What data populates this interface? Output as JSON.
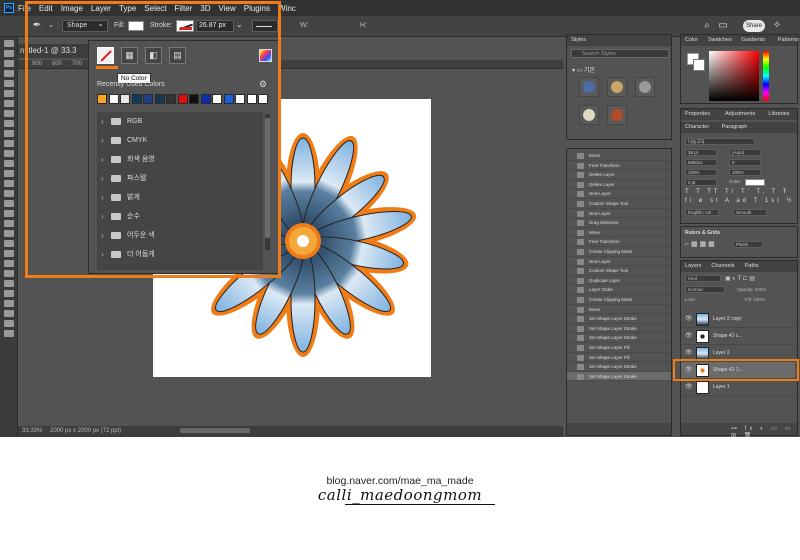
{
  "menubar": {
    "app_icon": "Ps",
    "items": [
      "File",
      "Edit",
      "Image",
      "Layer",
      "Type",
      "Select",
      "Filter",
      "3D",
      "View",
      "Plugins",
      "Winc"
    ]
  },
  "options_bar": {
    "tool_icon": "pen-tool-icon",
    "mode": "Shape",
    "fill_label": "Fill:",
    "stroke_label": "Stroke:",
    "stroke_width": "26.87 px",
    "w_label": "W:",
    "h_label": "H:",
    "share": "Share"
  },
  "document": {
    "tab_title": "ntitled-1 @ 33.3",
    "ruler_ticks": [
      "900",
      "800",
      "700"
    ],
    "zoom": "33.33%",
    "doc_size": "2000 px x 2000 px (72 ppi)"
  },
  "fill_popup": {
    "tooltip": "No Color",
    "recent_label": "Recently Used Colors",
    "recent_colors": [
      "#f5a623",
      "#ffffff",
      "#e8e8e8",
      "#0b3d5c",
      "#1f3c88",
      "#143a52",
      "#333333",
      "#e01010",
      "#111111",
      "#0b2fb0",
      "#ffffff",
      "#1a5fe0",
      "#ffffff",
      "#ffffff",
      "#ffffff"
    ],
    "folders": [
      "RGB",
      "CMYK",
      "회색 음영",
      "파스텔",
      "밝게",
      "순수",
      "어두운 색",
      "더 어둡게"
    ]
  },
  "styles_panel": {
    "tab": "Styles",
    "search_placeholder": "Search Styles",
    "folder": "기본",
    "tiles": [
      "#4a6ea8",
      "#c7a867",
      "#9a9a9a",
      "#e0d8c0",
      "#b54a2a"
    ]
  },
  "history_panel": {
    "items": [
      "Move",
      "Free Transform",
      "Delete Layer",
      "Delete Layer",
      "New Layer",
      "Custom Shape Tool",
      "New Layer",
      "Drag Selection",
      "Move",
      "Free Transform",
      "Create Clipping Mask",
      "New Layer",
      "Custom Shape Tool",
      "Duplicate Layer",
      "Layer Order",
      "Create Clipping Mask",
      "Move",
      "Set Shape Layer Stroke",
      "Set Shape Layer Stroke",
      "Set Shape Layer Stroke",
      "Set Shape Layer Fill",
      "Set Shape Layer Fill",
      "Set Shape Layer Stroke",
      "Set Shape Layer Stroke"
    ]
  },
  "color_panel": {
    "tabs": [
      "Color",
      "Swatches",
      "Gradients",
      "Patterns"
    ]
  },
  "properties_panel": {
    "tabs": [
      "Properties",
      "Adjustments",
      "Libraries"
    ]
  },
  "character_panel": {
    "tabs": [
      "Character",
      "Paragraph"
    ],
    "font": "나눔고딕",
    "size": "36 pt",
    "leading": "(Auto)",
    "tracking": "0",
    "kerning": "Metrics",
    "scale_v": "100%",
    "scale_h": "100%",
    "baseline": "0 pt",
    "color_label": "Color:",
    "language": "English: UK",
    "aa": "Smooth"
  },
  "guides_panel": {
    "title": "Rulers & Grids",
    "unit": "Pixels"
  },
  "layers_panel": {
    "tabs": [
      "Layers",
      "Channels",
      "Paths"
    ],
    "kind": "Kind",
    "blend": "Normal",
    "opacity": "Opacity: 100%",
    "lock": "Lock:",
    "fill": "Fill: 100%",
    "layers": [
      {
        "name": "Layer 2 copy",
        "thumb": "photo"
      },
      {
        "name": "Shape 41 c...",
        "thumb": "shape"
      },
      {
        "name": "Layer 2",
        "thumb": "photo"
      },
      {
        "name": "Shape 41 1...",
        "thumb": "shape-orange"
      },
      {
        "name": "Layer 1",
        "thumb": "white"
      }
    ]
  },
  "footer": {
    "blog_url": "blog.naver.com/mae_ma_made",
    "signature": "calli_maedoongmom"
  }
}
